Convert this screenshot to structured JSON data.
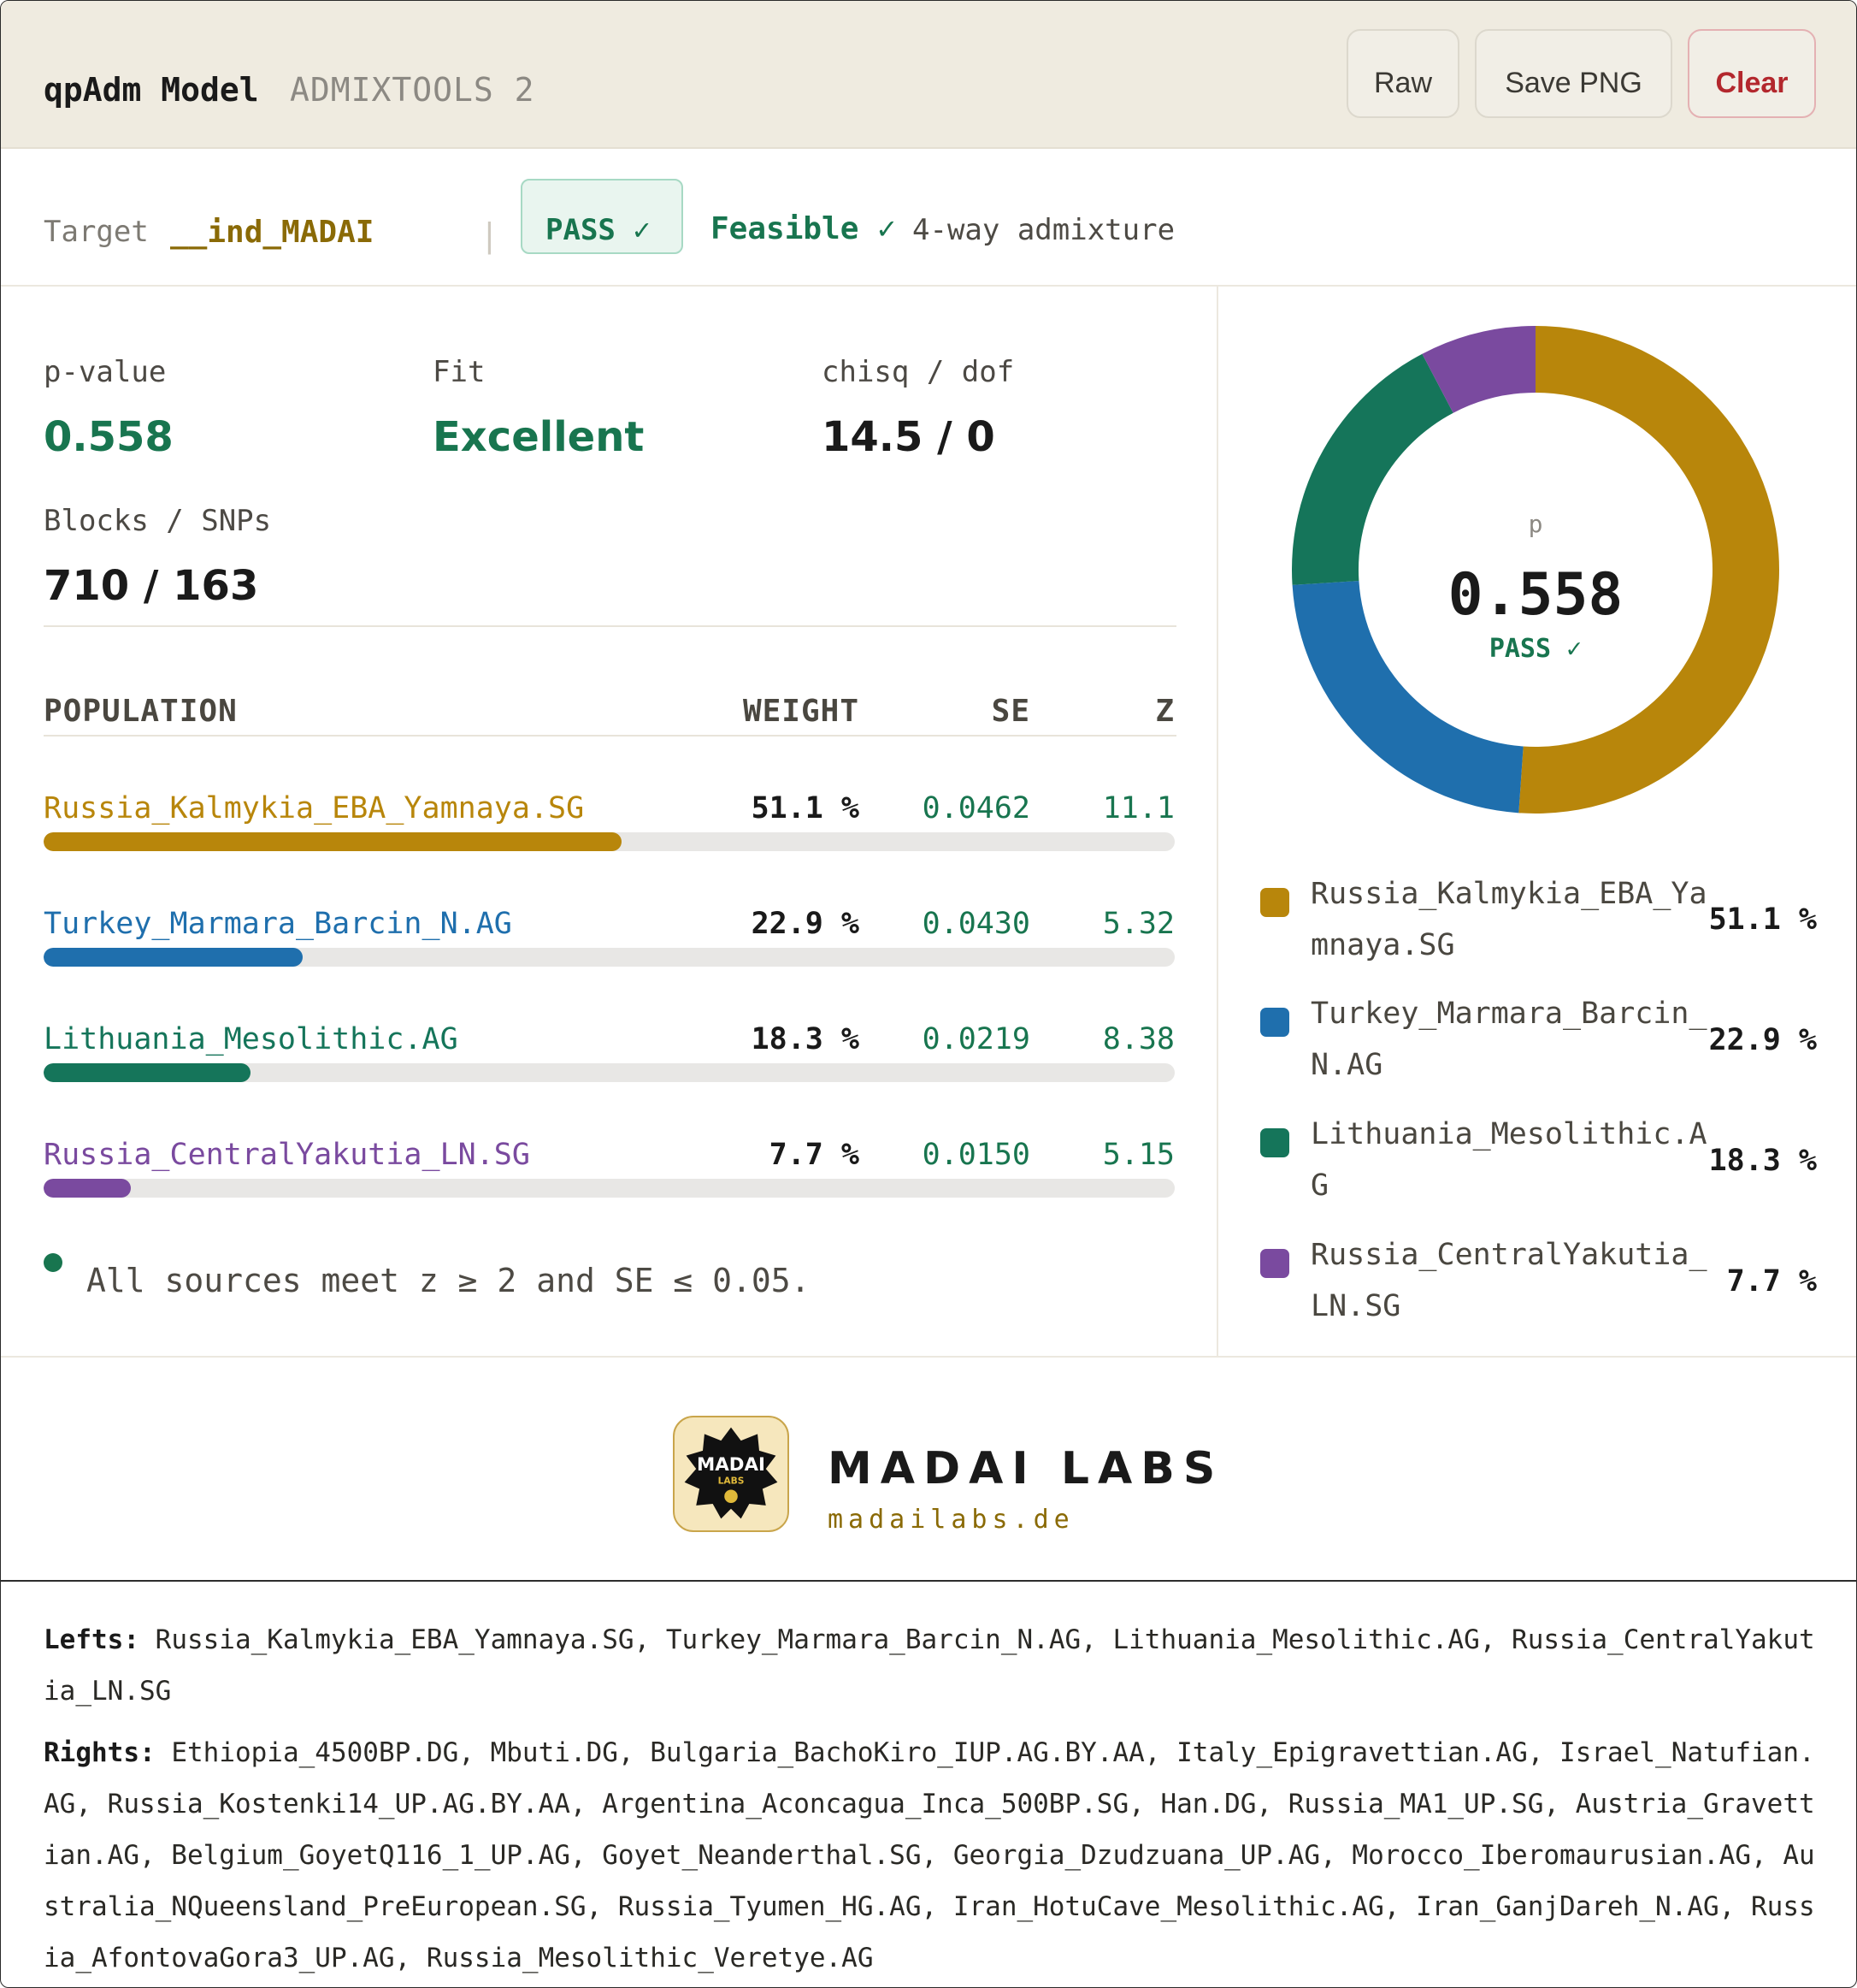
{
  "header": {
    "title": "qpAdm Model",
    "subtitle": "ADMIXTOOLS 2",
    "buttons": {
      "raw": "Raw",
      "save_png": "Save PNG",
      "clear": "Clear"
    }
  },
  "target": {
    "label": "Target",
    "value": "__ind_MADAI",
    "separator": "|",
    "pass_badge": "PASS ✓",
    "feasible": "Feasible ✓",
    "model_type": "4-way admixture"
  },
  "stats": {
    "pvalue_label": "p-value",
    "pvalue": "0.558",
    "fit_label": "Fit",
    "fit": "Excellent",
    "chisq_label": "chisq / dof",
    "chisq": "14.5 / 0",
    "blocks_label": "Blocks / SNPs",
    "blocks": "710 / 163"
  },
  "table": {
    "headers": {
      "population": "POPULATION",
      "weight": "WEIGHT",
      "se": "SE",
      "z": "Z"
    },
    "rows": [
      {
        "name": "Russia_Kalmykia_EBA_Yamnaya.SG",
        "weight": "51.1 %",
        "se": "0.0462",
        "z": "11.1",
        "fraction": 0.511,
        "color": "#b8860b"
      },
      {
        "name": "Turkey_Marmara_Barcin_N.AG",
        "weight": "22.9 %",
        "se": "0.0430",
        "z": "5.32",
        "fraction": 0.229,
        "color": "#1f6fad"
      },
      {
        "name": "Lithuania_Mesolithic.AG",
        "weight": "18.3 %",
        "se": "0.0219",
        "z": "8.38",
        "fraction": 0.183,
        "color": "#15755a"
      },
      {
        "name": "Russia_CentralYakutia_LN.SG",
        "weight": "7.7 %",
        "se": "0.0150",
        "z": "5.15",
        "fraction": 0.077,
        "color": "#7a4a9f"
      }
    ],
    "note": "All sources meet z ≥ 2 and SE ≤ 0.05."
  },
  "donut": {
    "center_label": "p",
    "center_value": "0.558",
    "center_status": "PASS ✓"
  },
  "legend": [
    {
      "name": "Russia_Kalmykia_EBA_Yamnaya.SG",
      "pct": "51.1 %"
    },
    {
      "name": "Turkey_Marmara_Barcin_N.AG",
      "pct": "22.9 %"
    },
    {
      "name": "Lithuania_Mesolithic.AG",
      "pct": "18.3 %"
    },
    {
      "name": "Russia_CentralYakutia_LN.SG",
      "pct": "7.7 %"
    }
  ],
  "brand": {
    "logo_text": "MADAI",
    "logo_sub": "LABS",
    "name": "MADAI LABS",
    "url": "madailabs.de"
  },
  "footer": {
    "lefts_label": "Lefts:",
    "lefts": "Russia_Kalmykia_EBA_Yamnaya.SG, Turkey_Marmara_Barcin_N.AG, Lithuania_Mesolithic.AG, Russia_CentralYakutia_LN.SG",
    "rights_label": "Rights:",
    "rights": "Ethiopia_4500BP.DG, Mbuti.DG, Bulgaria_BachoKiro_IUP.AG.BY.AA, Italy_Epigravettian.AG, Israel_Natufian.AG, Russia_Kostenki14_UP.AG.BY.AA, Argentina_Aconcagua_Inca_500BP.SG, Han.DG, Russia_MA1_UP.SG, Austria_Gravettian.AG, Belgium_GoyetQ116_1_UP.AG, Goyet_Neanderthal.SG, Georgia_Dzudzuana_UP.AG, Morocco_Iberomaurusian.AG, Australia_NQueensland_PreEuropean.SG, Russia_Tyumen_HG.AG, Iran_HotuCave_Mesolithic.AG, Iran_GanjDareh_N.AG, Russia_AfontovaGora3_UP.AG, Russia_Mesolithic_Veretye.AG"
  }
}
